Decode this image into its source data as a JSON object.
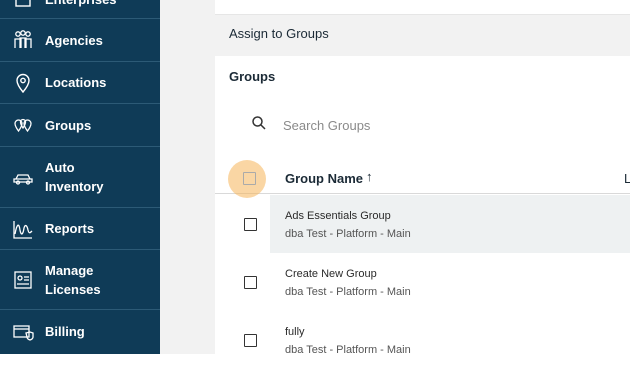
{
  "sidebar": {
    "items": [
      {
        "label": "Enterprises",
        "icon": "enterprise-icon"
      },
      {
        "label": "Agencies",
        "icon": "people-icon"
      },
      {
        "label": "Locations",
        "icon": "location-pin-icon"
      },
      {
        "label": "Groups",
        "icon": "group-pins-icon"
      },
      {
        "label": "Auto\nInventory",
        "icon": "car-icon"
      },
      {
        "label": "Reports",
        "icon": "chart-icon"
      },
      {
        "label": "Manage\nLicenses",
        "icon": "license-icon"
      },
      {
        "label": "Billing",
        "icon": "billing-icon"
      }
    ]
  },
  "panel": {
    "title": "Assign to Groups",
    "section_title": "Groups",
    "search": {
      "placeholder": "Search Groups"
    },
    "table": {
      "headers": {
        "name": "Group Name",
        "sort_indicator": "↑",
        "next_col": "L"
      },
      "rows": [
        {
          "name": "Ads Essentials Group",
          "sub": "dba Test - Platform - Main"
        },
        {
          "name": "Create New Group",
          "sub": "dba Test - Platform - Main"
        },
        {
          "name": "fully",
          "sub": "dba Test - Platform - Main"
        }
      ]
    }
  }
}
